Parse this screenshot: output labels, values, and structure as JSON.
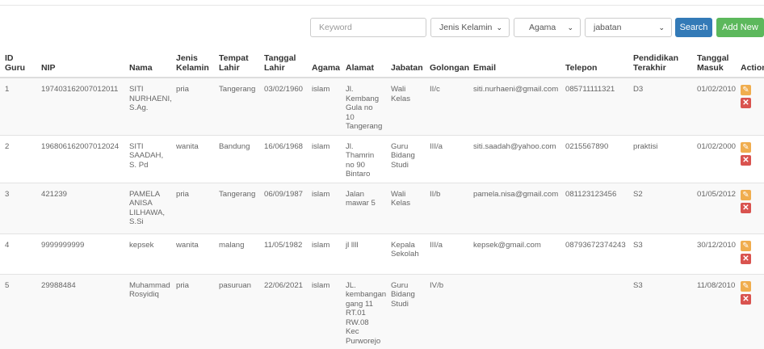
{
  "filters": {
    "keyword_placeholder": "Keyword",
    "gender_select": "Jenis Kelamin",
    "religion_select": "Agama",
    "position_select": "jabatan",
    "search_label": "Search",
    "add_label": "Add New"
  },
  "table": {
    "headers": {
      "id": "ID Guru",
      "nip": "NIP",
      "nama": "Nama",
      "jenis_kelamin": "Jenis Kelamin",
      "tempat_lahir": "Tempat Lahir",
      "tanggal_lahir": "Tanggal Lahir",
      "agama": "Agama",
      "alamat": "Alamat",
      "jabatan": "Jabatan",
      "golongan": "Golongan",
      "email": "Email",
      "telepon": "Telepon",
      "pendidikan": "Pendidikan Terakhir",
      "tanggal_masuk": "Tanggal Masuk",
      "action": "Action"
    },
    "rows": [
      {
        "id": "1",
        "nip": "197403162007012011",
        "nama": "SITI NURHAENI, S.Ag.",
        "jk": "pria",
        "tempat": "Tangerang",
        "tgl_lahir": "03/02/1960",
        "agama": "islam",
        "alamat": "Jl. Kembang Gula no 10 Tangerang",
        "jabatan": "Wali Kelas",
        "golongan": "II/c",
        "email": "siti.nurhaeni@gmail.com",
        "telepon": "085711111321",
        "pendidikan": "D3",
        "tgl_masuk": "01/02/2010"
      },
      {
        "id": "2",
        "nip": "196806162007012024",
        "nama": "SITI SAADAH, S. Pd",
        "jk": "wanita",
        "tempat": "Bandung",
        "tgl_lahir": "16/06/1968",
        "agama": "islam",
        "alamat": "Jl. Thamrin no 90 Bintaro",
        "jabatan": "Guru Bidang Studi",
        "golongan": "III/a",
        "email": "siti.saadah@yahoo.com",
        "telepon": "0215567890",
        "pendidikan": "praktisi",
        "tgl_masuk": "01/02/2000"
      },
      {
        "id": "3",
        "nip": "421239",
        "nama": "PAMELA ANISA LILHAWA, S.Si",
        "jk": "pria",
        "tempat": "Tangerang",
        "tgl_lahir": "06/09/1987",
        "agama": "islam",
        "alamat": "Jalan mawar 5",
        "jabatan": "Wali Kelas",
        "golongan": "II/b",
        "email": "pamela.nisa@gmail.com",
        "telepon": "081123123456",
        "pendidikan": "S2",
        "tgl_masuk": "01/05/2012"
      },
      {
        "id": "4",
        "nip": "9999999999",
        "nama": "kepsek",
        "jk": "wanita",
        "tempat": "malang",
        "tgl_lahir": "11/05/1982",
        "agama": "islam",
        "alamat": "jl llll",
        "jabatan": "Kepala Sekolah",
        "golongan": "III/a",
        "email": "kepsek@gmail.com",
        "telepon": "08793672374243",
        "pendidikan": "S3",
        "tgl_masuk": "30/12/2010"
      },
      {
        "id": "5",
        "nip": "29988484",
        "nama": "Muhammad Rosyidiq",
        "jk": "pria",
        "tempat": "pasuruan",
        "tgl_lahir": "22/06/2021",
        "agama": "islam",
        "alamat": "JL. kembangan gang 11 RT.01 RW.08 Kec Purworejo",
        "jabatan": "Guru Bidang Studi",
        "golongan": "IV/b",
        "email": "",
        "telepon": "",
        "pendidikan": "S3",
        "tgl_masuk": "11/08/2010"
      }
    ]
  },
  "icons": {
    "edit": "edit-icon",
    "delete": "delete-icon"
  },
  "colors": {
    "search": "#337ab7",
    "add": "#5cb85c",
    "edit": "#f0ad4e",
    "delete": "#d9534f"
  }
}
